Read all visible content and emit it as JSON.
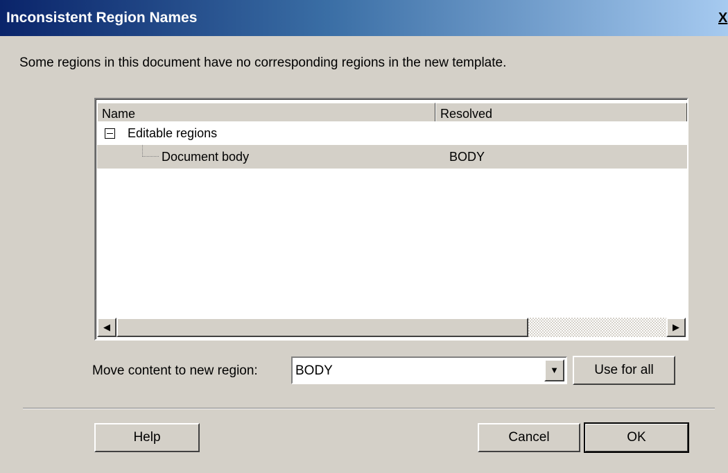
{
  "window": {
    "title": "Inconsistent Region Names",
    "close_label": "X"
  },
  "message": "Some regions in this document have no corresponding regions in the new template.",
  "list": {
    "columns": [
      "Name",
      "Resolved"
    ],
    "rows": [
      {
        "name": "Editable regions",
        "resolved": "",
        "expanded": true
      },
      {
        "name": "Document body",
        "resolved": "BODY",
        "selected": true
      }
    ]
  },
  "move": {
    "label": "Move content to new region:",
    "value": "BODY",
    "use_for_all_label": "Use for all"
  },
  "footer": {
    "help_label": "Help",
    "cancel_label": "Cancel",
    "ok_label": "OK"
  },
  "icons": {
    "scroll_left": "scroll-left-arrow",
    "scroll_right": "scroll-right-arrow",
    "dropdown": "chevron-down",
    "expander": "minus-box"
  }
}
